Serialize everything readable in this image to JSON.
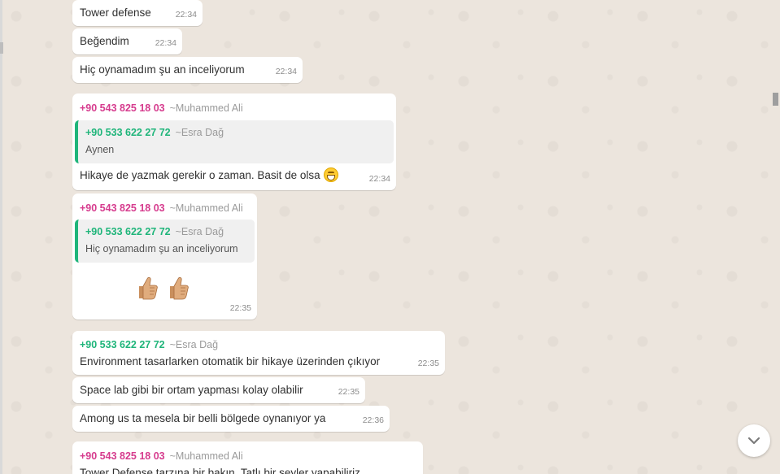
{
  "messages": [
    {
      "text": "Tower defense",
      "time": "22:34"
    },
    {
      "text": "Beğendim",
      "time": "22:34"
    },
    {
      "text": "Hiç oynamadım şu an inceliyorum",
      "time": "22:34"
    },
    {
      "sender_phone": "+90 543 825 18 03",
      "sender_name": "~Muhammed Ali",
      "quote": {
        "phone": "+90 533 622 27 72",
        "name": "~Esra Dağ",
        "text": "Aynen"
      },
      "text": "Hikaye de yazmak gerekir o zaman. Basit de olsa",
      "emoji": "grinning-face",
      "time": "22:34"
    },
    {
      "sender_phone": "+90 543 825 18 03",
      "sender_name": "~Muhammed Ali",
      "quote": {
        "phone": "+90 533 622 27 72",
        "name": "~Esra Dağ",
        "text": "Hiç oynamadım şu an inceliyorum"
      },
      "emoji": "thumbs-up x2",
      "time": "22:35"
    },
    {
      "sender_phone": "+90 533 622 27 72",
      "sender_name": "~Esra Dağ",
      "text": "Environment tasarlarken otomatik bir hikaye üzerinden çıkıyor",
      "time": "22:35"
    },
    {
      "text": "Space lab gibi bir ortam yapması kolay olabilir",
      "time": "22:35"
    },
    {
      "text": "Among us ta mesela bir belli bölgede oynanıyor ya",
      "time": "22:36"
    },
    {
      "sender_phone": "+90 543 825 18 03",
      "sender_name": "~Muhammed Ali",
      "text": "Tower Defense tarzına bir bakın. Tatlı bir şeyler yapabiliriz"
    }
  ],
  "colors": {
    "pink_sender": "#d63c8e",
    "green_sender": "#1fb57a",
    "chat_bg": "#ece5dd"
  },
  "icons": {
    "scroll_down": "chevron-down-icon"
  }
}
